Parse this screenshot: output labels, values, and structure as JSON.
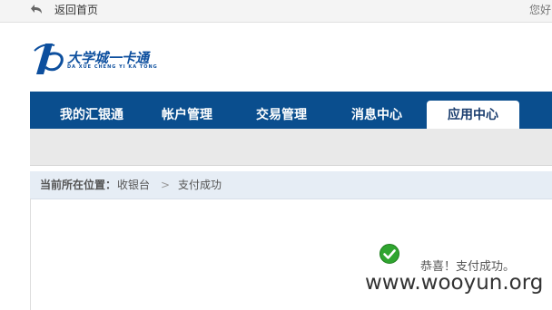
{
  "topbar": {
    "back_label": "返回首页",
    "greeting": "您好"
  },
  "logo": {
    "text": "大学城一卡通",
    "subtext": "DA XUE CHENG YI KA TONG"
  },
  "nav": {
    "items": [
      {
        "label": "我的汇银通"
      },
      {
        "label": "帐户管理"
      },
      {
        "label": "交易管理"
      },
      {
        "label": "消息中心"
      },
      {
        "label": "应用中心"
      }
    ],
    "active": "应用中心"
  },
  "breadcrumb": {
    "label": "当前所在位置：",
    "items": [
      "收银台",
      "支付成功"
    ],
    "separator": ">"
  },
  "main": {
    "success_message": "恭喜！支付成功。"
  },
  "watermark": {
    "text": "www.wooyun.org"
  },
  "colors": {
    "nav_bg": "#0a4e8e",
    "success_green": "#2fa52f",
    "crumb_bg": "#e6edf5"
  },
  "icons": {
    "back": "back-arrow-icon",
    "success": "check-circle-icon"
  }
}
